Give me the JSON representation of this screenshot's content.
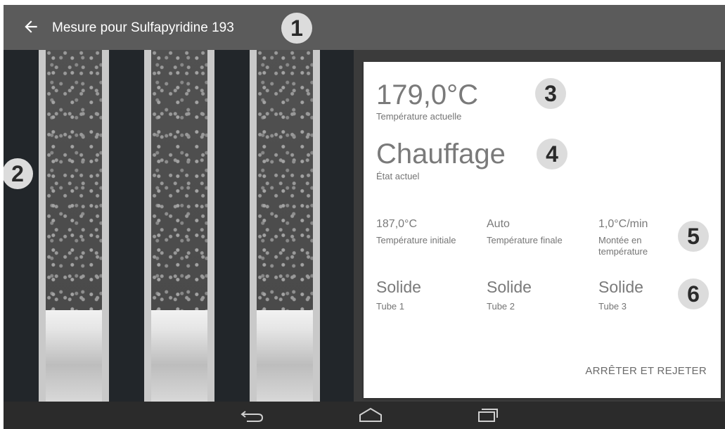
{
  "header": {
    "title": "Mesure pour Sulfapyridine 193",
    "back_icon": "arrow-left-icon"
  },
  "temperature": {
    "value": "179,0°C",
    "label": "Température actuelle"
  },
  "state": {
    "value": "Chauffage",
    "label": "État actuel"
  },
  "parameters": [
    {
      "value": "187,0°C",
      "label": "Température initiale"
    },
    {
      "value": "Auto",
      "label": "Température finale"
    },
    {
      "value": "1,0°C/min",
      "label": "Montée en température"
    }
  ],
  "tubes": [
    {
      "value": "Solide",
      "label": "Tube 1"
    },
    {
      "value": "Solide",
      "label": "Tube 2"
    },
    {
      "value": "Solide",
      "label": "Tube 3"
    }
  ],
  "action": {
    "label": "ARRÊTER ET REJETER"
  },
  "callouts": [
    "1",
    "2",
    "3",
    "4",
    "5",
    "6"
  ],
  "navbar": {
    "icons": [
      "back-nav-icon",
      "home-nav-icon",
      "recents-nav-icon"
    ]
  },
  "colors": {
    "appbar": "#5b5b5b",
    "background": "#3b3b3b",
    "card": "#ffffff",
    "text": "#7a7a7a",
    "callout": "#dcdcdc"
  }
}
